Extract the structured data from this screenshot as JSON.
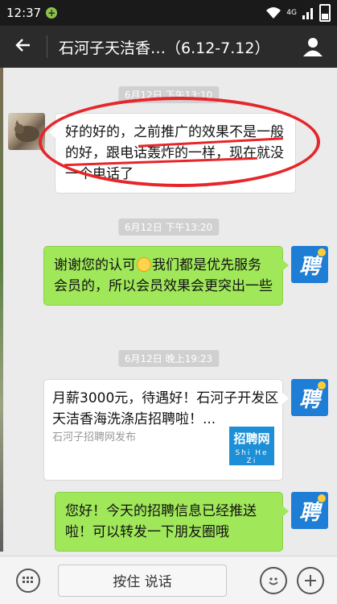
{
  "status_bar": {
    "time": "12:37",
    "notification": "+",
    "network": "4G"
  },
  "header": {
    "back_icon": "back-arrow-icon",
    "title": "石河子天洁香…（6.12-7.12）",
    "profile_icon": "person-icon"
  },
  "messages": [
    {
      "type": "timestamp",
      "text": "6月12日 下午13:10"
    },
    {
      "type": "text",
      "side": "left",
      "avatar": "cat-avatar",
      "text": "好的好的，之前推广的效果不是一般的好，跟电话轰炸的一样，现在就没一个电话了"
    },
    {
      "type": "timestamp",
      "text": "6月12日 下午13:20"
    },
    {
      "type": "text",
      "side": "right",
      "avatar": "聘",
      "text_before": "谢谢您的认可",
      "emoji": "smile-emoji",
      "text_after": "我们都是优先服务会员的，所以会员效果会更突出一些"
    },
    {
      "type": "timestamp",
      "text": "6月12日 晚上19:23"
    },
    {
      "type": "link_card",
      "side": "right",
      "avatar": "聘",
      "title": "月薪3000元，待遇好！石河子开发区天洁香海洗涤店招聘啦！...",
      "source": "石河子招聘网发布",
      "thumb_title": "招聘网",
      "thumb_subtitle": "Shi He Zi"
    },
    {
      "type": "text",
      "side": "right",
      "avatar": "聘",
      "text": "您好！今天的招聘信息已经推送啦！可以转发一下朋友圈哦"
    }
  ],
  "input_bar": {
    "keyboard_icon": "keyboard-icon",
    "voice_label": "按住 说话",
    "emoji_icon": "smiley-icon",
    "plus_icon": "plus-icon"
  },
  "colors": {
    "bubble_right": "#a0e75a",
    "bubble_left": "#ffffff",
    "titlebar": "#2b2b2b",
    "annotation": "#e5262a",
    "brand_blue": "#1e7dd4"
  }
}
